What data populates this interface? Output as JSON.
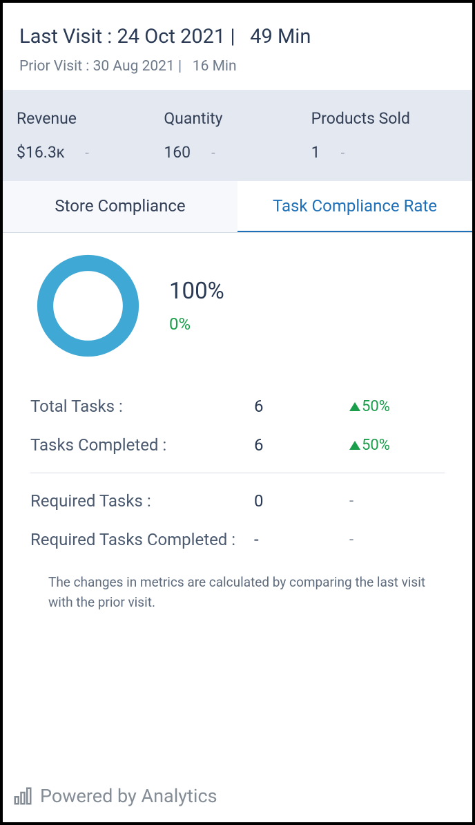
{
  "header": {
    "last_visit_label": "Last Visit :",
    "last_visit_date": "24 Oct 2021",
    "last_visit_duration": "49 Min",
    "prior_visit_label": "Prior Visit :",
    "prior_visit_date": "30 Aug 2021",
    "prior_visit_duration": "16 Min"
  },
  "metrics": {
    "revenue": {
      "label": "Revenue",
      "value": "$16.3ᴋ",
      "delta": "-"
    },
    "quantity": {
      "label": "Quantity",
      "value": "160",
      "delta": "-"
    },
    "products_sold": {
      "label": "Products Sold",
      "value": "1",
      "delta": "-"
    }
  },
  "tabs": {
    "store_compliance": "Store Compliance",
    "task_compliance_rate": "Task Compliance Rate"
  },
  "gauge": {
    "percent": "100%",
    "sub": "0%",
    "ring_color": "#3fa8d4"
  },
  "tasks": {
    "total": {
      "label": "Total Tasks :",
      "value": "6",
      "change": "50%"
    },
    "completed": {
      "label": "Tasks Completed :",
      "value": "6",
      "change": "50%"
    },
    "required": {
      "label": "Required Tasks :",
      "value": "0",
      "change": "-"
    },
    "required_completed": {
      "label": "Required Tasks Completed :",
      "value": "-",
      "change": "-"
    }
  },
  "footnote": "The changes in metrics are calculated by comparing the last visit with the prior visit.",
  "powered": "Powered by Analytics",
  "chart_data": {
    "type": "pie",
    "title": "Task Compliance Rate",
    "series": [
      {
        "name": "Compliance",
        "value": 100
      }
    ],
    "total": 100,
    "colors": [
      "#3fa8d4"
    ]
  }
}
